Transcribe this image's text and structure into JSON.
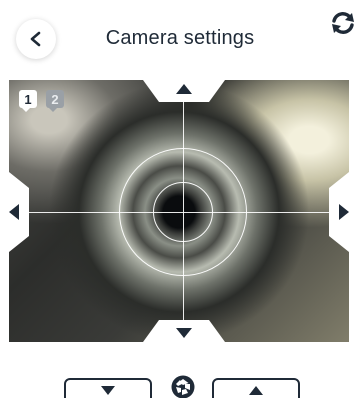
{
  "header": {
    "title": "Camera settings",
    "back_icon": "chevron-left-icon",
    "flip_icon": "camera-flip-icon"
  },
  "viewer": {
    "cameras": [
      {
        "label": "1",
        "active": true
      },
      {
        "label": "2",
        "active": false
      }
    ],
    "pan_controls": [
      "up",
      "down",
      "left",
      "right"
    ]
  },
  "controls": {
    "focus_down_icon": "triangle-down-icon",
    "focus_up_icon": "triangle-up-icon",
    "center_icon": "aperture-icon"
  },
  "colors": {
    "text": "#1f2a37",
    "background": "#ffffff",
    "inactive_badge": "#9aa0a6"
  }
}
